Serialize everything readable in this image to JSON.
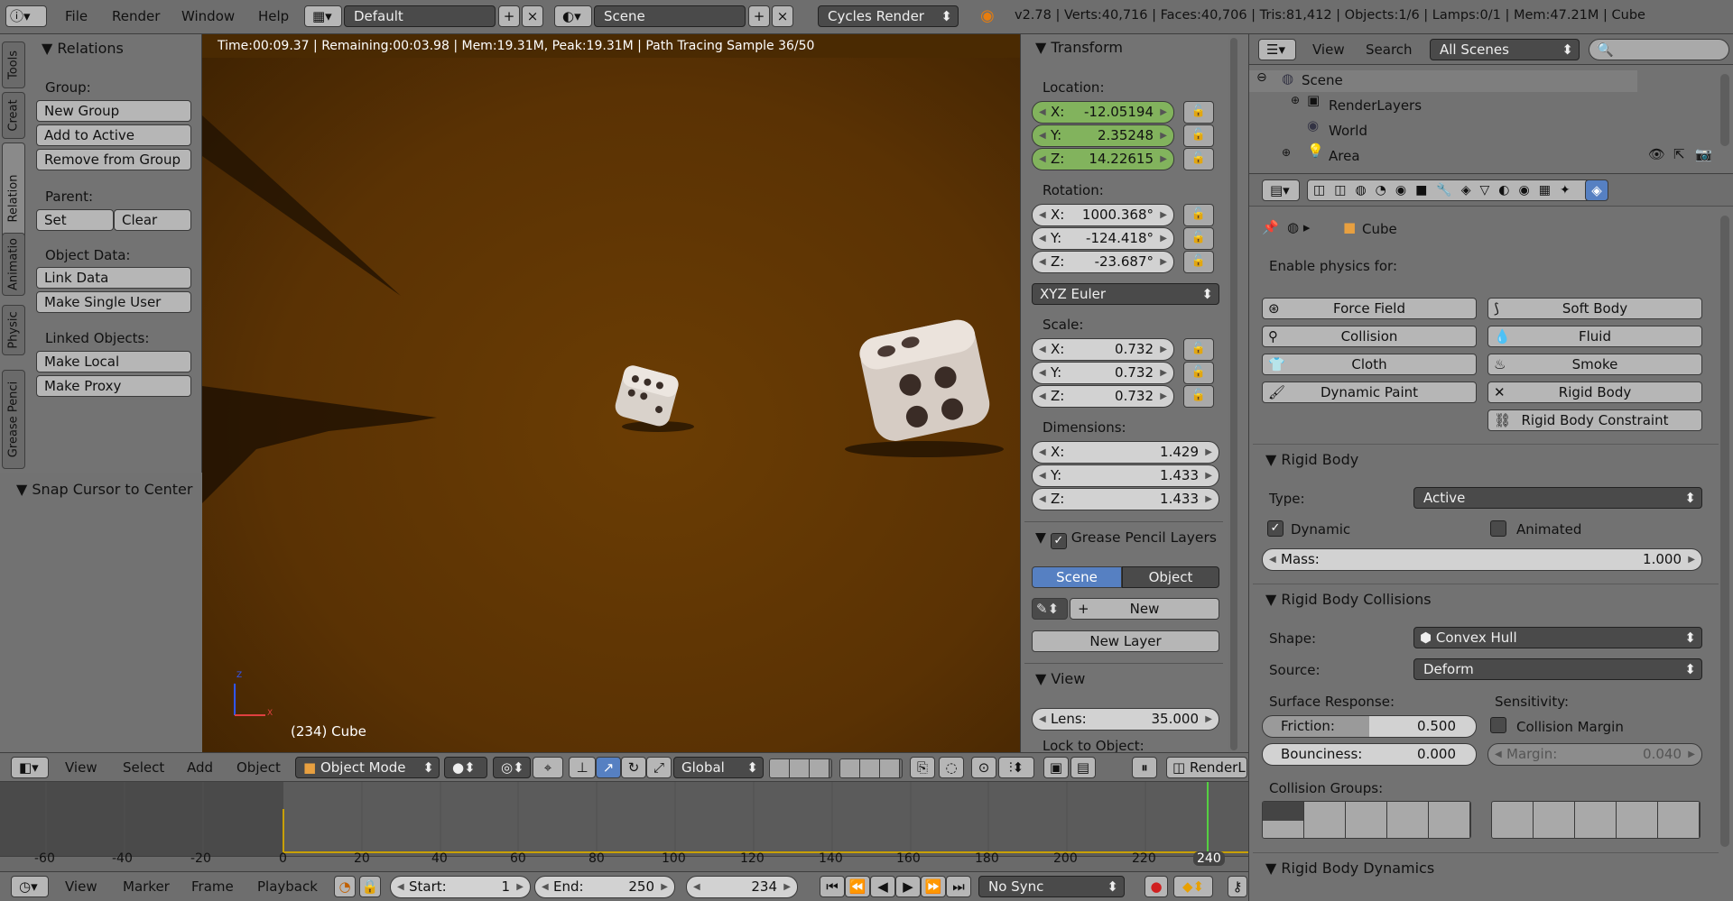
{
  "topbar": {
    "menus": [
      "File",
      "Render",
      "Window",
      "Help"
    ],
    "layout": "Default",
    "scene": "Scene",
    "engine": "Cycles Render",
    "stats": "v2.78 | Verts:40,716 | Faces:40,706 | Tris:81,412 | Objects:1/6 | Lamps:0/1 | Mem:47.21M | Cube"
  },
  "tools": {
    "tabs": [
      "Tools",
      "Creat",
      "Relation",
      "Animatio",
      "Physic",
      "Grease Penci"
    ],
    "relations": "Relations",
    "group_label": "Group:",
    "new_group": "New Group",
    "add_active": "Add to Active",
    "remove_group": "Remove from Group",
    "parent_label": "Parent:",
    "set": "Set",
    "clear": "Clear",
    "objdata_label": "Object Data:",
    "link_data": "Link Data",
    "make_single": "Make Single User",
    "linked_label": "Linked Objects:",
    "make_local": "Make Local",
    "make_proxy": "Make Proxy",
    "snap": "Snap Cursor to Center"
  },
  "viewport": {
    "status": "Time:00:09.37 | Remaining:00:03.98 | Mem:19.31M, Peak:19.31M | Path Tracing Sample 36/50",
    "object_label": "(234) Cube",
    "axis_z": "Z",
    "axis_x": "X"
  },
  "transform": {
    "title": "Transform",
    "location": "Location:",
    "loc": [
      "-12.05194",
      "2.35248",
      "14.22615"
    ],
    "rotation": "Rotation:",
    "rot": [
      "1000.368°",
      "-124.418°",
      "-23.687°"
    ],
    "euler": "XYZ Euler",
    "scale_label": "Scale:",
    "scale": [
      "0.732",
      "0.732",
      "0.732"
    ],
    "dim_label": "Dimensions:",
    "dim": [
      "1.429",
      "1.433",
      "1.433"
    ],
    "axes": [
      "X:",
      "Y:",
      "Z:"
    ],
    "gp_title": "Grease Pencil Layers",
    "gp_scene": "Scene",
    "gp_object": "Object",
    "gp_new": "New",
    "gp_new_layer": "New Layer",
    "view_title": "View",
    "lens_label": "Lens:",
    "lens": "35.000",
    "lock_obj": "Lock to Object:"
  },
  "header3d": {
    "view": "View",
    "select": "Select",
    "add": "Add",
    "object": "Object",
    "mode": "Object Mode",
    "orient": "Global",
    "render_layer": "RenderL"
  },
  "timeline": {
    "ticks": [
      "-60",
      "-40",
      "-20",
      "0",
      "20",
      "40",
      "60",
      "80",
      "100",
      "120",
      "140",
      "160",
      "180",
      "200",
      "220",
      "240"
    ],
    "view": "View",
    "marker": "Marker",
    "frame": "Frame",
    "playback": "Playback",
    "start_label": "Start:",
    "start": "1",
    "end_label": "End:",
    "end": "250",
    "current": "234",
    "sync": "No Sync"
  },
  "outliner": {
    "view": "View",
    "search": "Search",
    "scenes": "All Scenes",
    "items": [
      "Scene",
      "RenderLayers",
      "World",
      "Area"
    ]
  },
  "properties": {
    "object": "Cube",
    "enable": "Enable physics for:",
    "buttons": [
      "Force Field",
      "Soft Body",
      "Collision",
      "Fluid",
      "Cloth",
      "Smoke",
      "Dynamic Paint",
      "Rigid Body",
      "Rigid Body Constraint"
    ],
    "rb_title": "Rigid Body",
    "type_label": "Type:",
    "type": "Active",
    "dynamic": "Dynamic",
    "animated": "Animated",
    "mass_label": "Mass:",
    "mass": "1.000",
    "rbc_title": "Rigid Body Collisions",
    "shape_label": "Shape:",
    "shape": "Convex Hull",
    "source_label": "Source:",
    "source": "Deform",
    "surface": "Surface Response:",
    "sensitivity": "Sensitivity:",
    "friction_label": "Friction:",
    "friction": "0.500",
    "friction_fill": 0.5,
    "collision_margin": "Collision Margin",
    "bounciness_label": "Bounciness:",
    "bounciness": "0.000",
    "margin_label": "Margin:",
    "margin": "0.040",
    "groups": "Collision Groups:",
    "rbd_title": "Rigid Body Dynamics"
  }
}
